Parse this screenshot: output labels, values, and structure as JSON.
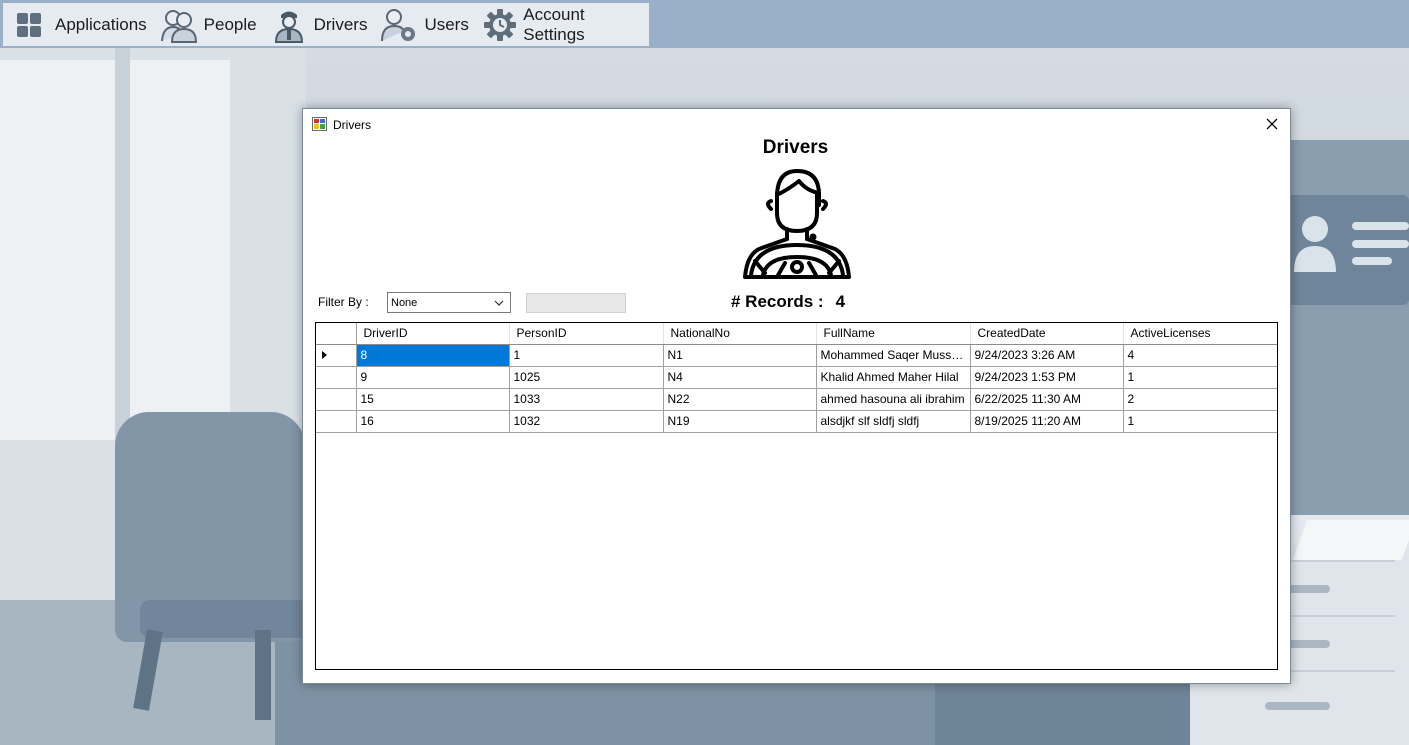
{
  "menu": {
    "items": [
      {
        "label": "Applications",
        "icon": "applications-grid-icon"
      },
      {
        "label": "People",
        "icon": "people-icon"
      },
      {
        "label": "Drivers",
        "icon": "driver-icon"
      },
      {
        "label": "Users",
        "icon": "users-gear-icon"
      },
      {
        "label": "Account Settings",
        "icon": "gear-icon"
      }
    ]
  },
  "window": {
    "title": "Drivers",
    "heading": "Drivers"
  },
  "filter": {
    "label": "Filter By :",
    "selected": "None"
  },
  "records": {
    "label": "# Records :",
    "count": "4"
  },
  "grid": {
    "columns": [
      "DriverID",
      "PersonID",
      "NationalNo",
      "FullName",
      "CreatedDate",
      "ActiveLicenses"
    ],
    "rows": [
      [
        "8",
        "1",
        "N1",
        "Mohammed Saqer Mussa Ab...",
        "9/24/2023 3:26 AM",
        "4"
      ],
      [
        "9",
        "1025",
        "N4",
        "Khalid Ahmed Maher Hilal",
        "9/24/2023 1:53 PM",
        "1"
      ],
      [
        "15",
        "1033",
        "N22",
        "ahmed hasouna ali ibrahim",
        "6/22/2025 11:30 AM",
        "2"
      ],
      [
        "16",
        "1032",
        "N19",
        "alsdjkf slf sldfj sldfj",
        "8/19/2025 11:20 AM",
        "1"
      ]
    ]
  },
  "colors": {
    "menu_strip": "#9ab0c9",
    "menu_bg": "#e6ebf1",
    "selection": "#0078d7"
  }
}
